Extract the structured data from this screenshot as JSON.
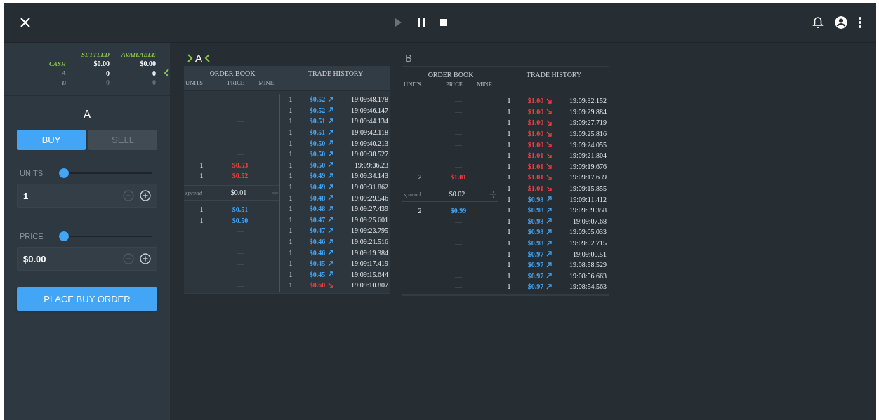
{
  "top_bar": {
    "controls": [
      {
        "kind": "play",
        "disabled": true
      },
      {
        "kind": "pause",
        "disabled": false
      },
      {
        "kind": "stop",
        "disabled": false
      }
    ]
  },
  "holdings": {
    "columns": [
      "SETTLED",
      "AVAILABLE"
    ],
    "rows": [
      {
        "kind": "cash",
        "label": "CASH",
        "settled": "$0.00",
        "available": "$0.00",
        "selected": false,
        "dimmed": false
      },
      {
        "kind": "asset",
        "label": "A",
        "settled": "0",
        "available": "0",
        "selected": true,
        "dimmed": false
      },
      {
        "kind": "asset",
        "label": "B",
        "settled": "0",
        "available": "0",
        "selected": false,
        "dimmed": true
      }
    ]
  },
  "order_form": {
    "title": "A",
    "sides": [
      {
        "label": "BUY",
        "selected": true
      },
      {
        "label": "SELL",
        "selected": false
      }
    ],
    "fields": [
      {
        "label": "UNITS",
        "level": 0,
        "value": "1",
        "minus_disabled": true
      },
      {
        "label": "PRICE",
        "level": 0,
        "value": "$0.00",
        "minus_disabled": true
      }
    ],
    "submit": "PLACE BUY ORDER"
  },
  "markets": [
    {
      "name": "A",
      "focused": true,
      "book_title": "ORDER BOOK",
      "history_title": "TRADE HISTORY",
      "columns": [
        "UNITS",
        "PRICE",
        "MINE"
      ],
      "asks": [
        {
          "price": "—"
        },
        {
          "price": "—"
        },
        {
          "price": "—"
        },
        {
          "price": "—"
        },
        {
          "price": "—"
        },
        {
          "price": "—"
        },
        {
          "units": "1",
          "price": "$0.53"
        },
        {
          "units": "1",
          "price": "$0.52"
        }
      ],
      "spread_label": "spread",
      "spread": "$0.01",
      "bids": [
        {
          "units": "1",
          "price": "$0.51"
        },
        {
          "units": "1",
          "price": "$0.50"
        },
        {
          "price": "—"
        },
        {
          "price": "—"
        },
        {
          "price": "—"
        },
        {
          "price": "—"
        },
        {
          "price": "—"
        },
        {
          "price": "—"
        }
      ],
      "trades": [
        {
          "units": "1",
          "price": "$0.52",
          "up": true,
          "time": "19:09:48.178"
        },
        {
          "units": "1",
          "price": "$0.52",
          "up": true,
          "time": "19:09:46.147"
        },
        {
          "units": "1",
          "price": "$0.51",
          "up": true,
          "time": "19:09:44.134"
        },
        {
          "units": "1",
          "price": "$0.51",
          "up": true,
          "time": "19:09:42.118"
        },
        {
          "units": "1",
          "price": "$0.50",
          "up": true,
          "time": "19:09:40.213"
        },
        {
          "units": "1",
          "price": "$0.50",
          "up": true,
          "time": "19:09:38.527"
        },
        {
          "units": "1",
          "price": "$0.50",
          "up": true,
          "time": "19:09:36.23"
        },
        {
          "units": "1",
          "price": "$0.49",
          "up": true,
          "time": "19:09:34.143"
        },
        {
          "units": "1",
          "price": "$0.49",
          "up": true,
          "time": "19:09:31.862"
        },
        {
          "units": "1",
          "price": "$0.48",
          "up": true,
          "time": "19:09:29.546"
        },
        {
          "units": "1",
          "price": "$0.48",
          "up": true,
          "time": "19:09:27.439"
        },
        {
          "units": "1",
          "price": "$0.47",
          "up": true,
          "time": "19:09:25.601"
        },
        {
          "units": "1",
          "price": "$0.47",
          "up": true,
          "time": "19:09:23.795"
        },
        {
          "units": "1",
          "price": "$0.46",
          "up": true,
          "time": "19:09:21.516"
        },
        {
          "units": "1",
          "price": "$0.46",
          "up": true,
          "time": "19:09:19.384"
        },
        {
          "units": "1",
          "price": "$0.45",
          "up": true,
          "time": "19:09:17.419"
        },
        {
          "units": "1",
          "price": "$0.45",
          "up": true,
          "time": "19:09:15.644"
        },
        {
          "units": "1",
          "price": "$0.60",
          "up": false,
          "time": "19:09:10.807"
        }
      ]
    },
    {
      "name": "B",
      "focused": false,
      "book_title": "ORDER BOOK",
      "history_title": "TRADE HISTORY",
      "columns": [
        "UNITS",
        "PRICE",
        "MINE"
      ],
      "asks": [
        {
          "price": "—"
        },
        {
          "price": "—"
        },
        {
          "price": "—"
        },
        {
          "price": "—"
        },
        {
          "price": "—"
        },
        {
          "price": "—"
        },
        {
          "price": "—"
        },
        {
          "units": "2",
          "price": "$1.01"
        }
      ],
      "spread_label": "spread",
      "spread": "$0.02",
      "bids": [
        {
          "units": "2",
          "price": "$0.99"
        },
        {
          "price": "—"
        },
        {
          "price": "—"
        },
        {
          "price": "—"
        },
        {
          "price": "—"
        },
        {
          "price": "—"
        },
        {
          "price": "—"
        },
        {
          "price": "—"
        }
      ],
      "trades": [
        {
          "units": "1",
          "price": "$1.00",
          "up": false,
          "time": "19:09:32.152"
        },
        {
          "units": "1",
          "price": "$1.00",
          "up": false,
          "time": "19:09:29.884"
        },
        {
          "units": "1",
          "price": "$1.00",
          "up": false,
          "time": "19:09:27.719"
        },
        {
          "units": "1",
          "price": "$1.00",
          "up": false,
          "time": "19:09:25.816"
        },
        {
          "units": "1",
          "price": "$1.00",
          "up": false,
          "time": "19:09:24.055"
        },
        {
          "units": "1",
          "price": "$1.01",
          "up": false,
          "time": "19:09:21.804"
        },
        {
          "units": "1",
          "price": "$1.01",
          "up": false,
          "time": "19:09:19.676"
        },
        {
          "units": "1",
          "price": "$1.01",
          "up": false,
          "time": "19:09:17.639"
        },
        {
          "units": "1",
          "price": "$1.01",
          "up": false,
          "time": "19:09:15.855"
        },
        {
          "units": "1",
          "price": "$0.98",
          "up": true,
          "time": "19:09:11.412"
        },
        {
          "units": "1",
          "price": "$0.98",
          "up": true,
          "time": "19:09:09.358"
        },
        {
          "units": "1",
          "price": "$0.98",
          "up": true,
          "time": "19:09:07.68"
        },
        {
          "units": "1",
          "price": "$0.98",
          "up": true,
          "time": "19:09:05.033"
        },
        {
          "units": "1",
          "price": "$0.98",
          "up": true,
          "time": "19:09:02.715"
        },
        {
          "units": "1",
          "price": "$0.97",
          "up": true,
          "time": "19:09:00.51"
        },
        {
          "units": "1",
          "price": "$0.97",
          "up": true,
          "time": "19:08:58.529"
        },
        {
          "units": "1",
          "price": "$0.97",
          "up": true,
          "time": "19:08:56.663"
        },
        {
          "units": "1",
          "price": "$0.97",
          "up": true,
          "time": "19:08:54.563"
        }
      ]
    }
  ]
}
